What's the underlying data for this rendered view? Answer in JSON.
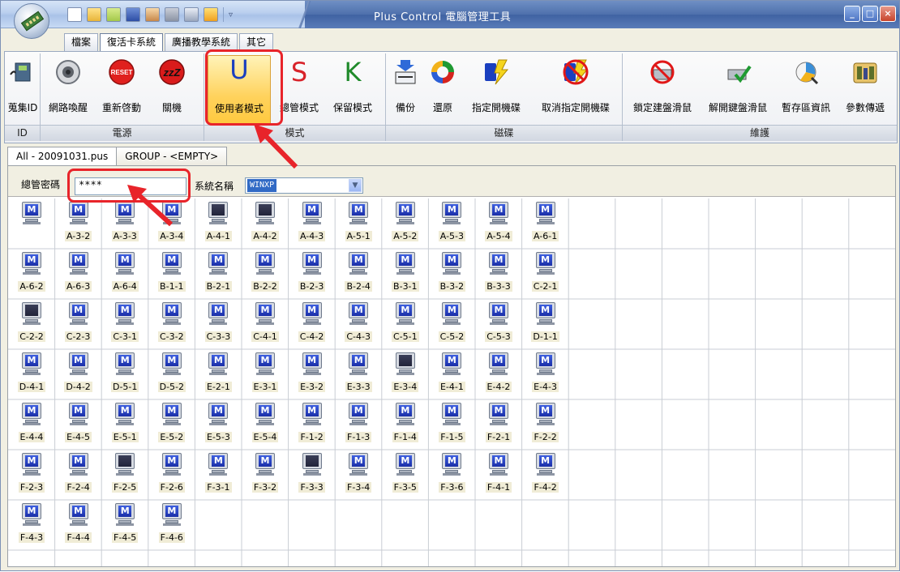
{
  "window": {
    "title": "Plus Control 電腦管理工具",
    "controls": [
      "minimize",
      "maximize",
      "close"
    ]
  },
  "quick_access": [
    "new-icon",
    "open-icon",
    "folder-icon",
    "save-icon",
    "user-icon",
    "stop-icon",
    "settings-icon",
    "flag-icon"
  ],
  "menu_tabs": [
    "檔案",
    "復活卡系統",
    "廣播教學系統",
    "其它"
  ],
  "active_menu_tab": "復活卡系統",
  "ribbon": {
    "groups": {
      "id": {
        "label": "ID",
        "buttons": [
          {
            "label": "蒐集ID",
            "icon": "network-card-icon"
          }
        ]
      },
      "power": {
        "label": "電源",
        "buttons": [
          {
            "label": "網路喚醒",
            "icon": "speaker-icon"
          },
          {
            "label": "重新啓動",
            "icon": "reset-icon",
            "icon_text": "RESET"
          },
          {
            "label": "關機",
            "icon": "sleep-icon",
            "icon_text": "zzZ"
          }
        ]
      },
      "mode": {
        "label": "模式",
        "buttons": [
          {
            "label": "使用者模式",
            "icon": "u-letter-icon",
            "letter": "U",
            "color": "#1a3fbf",
            "selected": true
          },
          {
            "label": "總管模式",
            "icon": "s-letter-icon",
            "letter": "S",
            "color": "#d8232a"
          },
          {
            "label": "保留模式",
            "icon": "k-letter-icon",
            "letter": "K",
            "color": "#1f8a2a"
          }
        ]
      },
      "disk": {
        "label": "磁碟",
        "buttons": [
          {
            "label": "備份",
            "icon": "backup-icon"
          },
          {
            "label": "還原",
            "icon": "restore-icon"
          },
          {
            "label": "指定開機碟",
            "icon": "boot-disk-icon"
          },
          {
            "label": "取消指定開機碟",
            "icon": "cancel-boot-disk-icon"
          }
        ]
      },
      "maintenance": {
        "label": "維護",
        "buttons": [
          {
            "label": "鎖定建盤滑鼠",
            "icon": "lock-input-icon"
          },
          {
            "label": "解開鍵盤滑鼠",
            "icon": "unlock-input-icon"
          },
          {
            "label": "暫存區資訊",
            "icon": "cache-info-icon"
          },
          {
            "label": "參數傳遞",
            "icon": "parameters-icon"
          }
        ]
      }
    }
  },
  "doc_tabs": [
    "All - 20091031.pus",
    "GROUP - <EMPTY>"
  ],
  "active_doc_tab": "All - 20091031.pus",
  "toolbar": {
    "password_label": "總管密碼",
    "password_value": "****",
    "system_label": "系統名稱",
    "system_value": "WINXP"
  },
  "computers": [
    {
      "label": "",
      "on": true
    },
    {
      "label": "A-3-2",
      "on": true
    },
    {
      "label": "A-3-3",
      "on": true
    },
    {
      "label": "A-3-4",
      "on": true
    },
    {
      "label": "A-4-1",
      "on": false
    },
    {
      "label": "A-4-2",
      "on": false
    },
    {
      "label": "A-4-3",
      "on": true
    },
    {
      "label": "A-5-1",
      "on": true
    },
    {
      "label": "A-5-2",
      "on": true
    },
    {
      "label": "A-5-3",
      "on": true
    },
    {
      "label": "A-5-4",
      "on": true
    },
    {
      "label": "A-6-1",
      "on": true
    },
    {
      "label": "A-6-2",
      "on": true
    },
    {
      "label": "A-6-3",
      "on": true
    },
    {
      "label": "A-6-4",
      "on": true
    },
    {
      "label": "B-1-1",
      "on": true
    },
    {
      "label": "B-2-1",
      "on": true
    },
    {
      "label": "B-2-2",
      "on": true
    },
    {
      "label": "B-2-3",
      "on": true
    },
    {
      "label": "B-2-4",
      "on": true
    },
    {
      "label": "B-3-1",
      "on": true
    },
    {
      "label": "B-3-2",
      "on": true
    },
    {
      "label": "B-3-3",
      "on": true
    },
    {
      "label": "C-2-1",
      "on": true
    },
    {
      "label": "C-2-2",
      "on": false
    },
    {
      "label": "C-2-3",
      "on": true
    },
    {
      "label": "C-3-1",
      "on": true
    },
    {
      "label": "C-3-2",
      "on": true
    },
    {
      "label": "C-3-3",
      "on": true
    },
    {
      "label": "C-4-1",
      "on": true
    },
    {
      "label": "C-4-2",
      "on": true
    },
    {
      "label": "C-4-3",
      "on": true
    },
    {
      "label": "C-5-1",
      "on": true
    },
    {
      "label": "C-5-2",
      "on": true
    },
    {
      "label": "C-5-3",
      "on": true
    },
    {
      "label": "D-1-1",
      "on": true
    },
    {
      "label": "D-4-1",
      "on": true
    },
    {
      "label": "D-4-2",
      "on": true
    },
    {
      "label": "D-5-1",
      "on": true
    },
    {
      "label": "D-5-2",
      "on": true
    },
    {
      "label": "E-2-1",
      "on": true
    },
    {
      "label": "E-3-1",
      "on": true
    },
    {
      "label": "E-3-2",
      "on": true
    },
    {
      "label": "E-3-3",
      "on": true
    },
    {
      "label": "E-3-4",
      "on": false
    },
    {
      "label": "E-4-1",
      "on": true
    },
    {
      "label": "E-4-2",
      "on": true
    },
    {
      "label": "E-4-3",
      "on": true
    },
    {
      "label": "E-4-4",
      "on": true
    },
    {
      "label": "E-4-5",
      "on": true
    },
    {
      "label": "E-5-1",
      "on": true
    },
    {
      "label": "E-5-2",
      "on": true
    },
    {
      "label": "E-5-3",
      "on": true
    },
    {
      "label": "E-5-4",
      "on": true
    },
    {
      "label": "F-1-2",
      "on": true
    },
    {
      "label": "F-1-3",
      "on": true
    },
    {
      "label": "F-1-4",
      "on": true
    },
    {
      "label": "F-1-5",
      "on": true
    },
    {
      "label": "F-2-1",
      "on": true
    },
    {
      "label": "F-2-2",
      "on": true
    },
    {
      "label": "F-2-3",
      "on": true
    },
    {
      "label": "F-2-4",
      "on": true
    },
    {
      "label": "F-2-5",
      "on": false
    },
    {
      "label": "F-2-6",
      "on": true
    },
    {
      "label": "F-3-1",
      "on": true
    },
    {
      "label": "F-3-2",
      "on": true
    },
    {
      "label": "F-3-3",
      "on": false
    },
    {
      "label": "F-3-4",
      "on": true
    },
    {
      "label": "F-3-5",
      "on": true
    },
    {
      "label": "F-3-6",
      "on": true
    },
    {
      "label": "F-4-1",
      "on": true
    },
    {
      "label": "F-4-2",
      "on": true
    },
    {
      "label": "F-4-3",
      "on": true
    },
    {
      "label": "F-4-4",
      "on": true
    },
    {
      "label": "F-4-5",
      "on": true
    },
    {
      "label": "F-4-6",
      "on": true
    }
  ],
  "monitor_letter": "M",
  "colors": {
    "highlight": "#e8242a",
    "selected_button": "#ffd25c",
    "monitor_on": "#2a44c8",
    "monitor_off": "#2c2f48"
  }
}
